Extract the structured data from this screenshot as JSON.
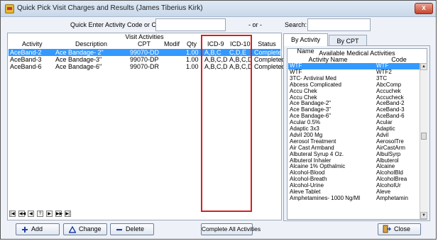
{
  "window": {
    "title": "Quick Pick Visit Charges and Results (James Tiberius Kirk)",
    "close_glyph": "x"
  },
  "quick_enter": {
    "label": "Quick Enter Activity Code or CPT:",
    "value": "",
    "or_label": "- or -",
    "search_label": "Search:",
    "search_value": ""
  },
  "visit_activities": {
    "caption": "Visit Activities",
    "columns": [
      "Activity",
      "Description",
      "CPT",
      "Modif",
      "Qty",
      "ICD-9",
      "ICD-10",
      "Status"
    ],
    "rows": [
      {
        "activity": "AceBand-2",
        "description": "Ace Bandage- 2\"",
        "cpt": "99070-DD",
        "modif": "",
        "qty": "1.00",
        "icd9": "A,B,C",
        "icd10": "C,D,E",
        "status": "Completed",
        "selected": true
      },
      {
        "activity": "AceBand-3",
        "description": "Ace Bandage-3\"",
        "cpt": "99070-DP",
        "modif": "",
        "qty": "1.00",
        "icd9": "A,B,C,D",
        "icd10": "A,B,C,D",
        "status": "Completed",
        "selected": false
      },
      {
        "activity": "AceBand-6",
        "description": "Ace Bandage-6\"",
        "cpt": "99070-DR",
        "modif": "",
        "qty": "1.00",
        "icd9": "A,B,C,D",
        "icd10": "A,B,C,D",
        "status": "Completed",
        "selected": false
      }
    ],
    "pager_glyphs": [
      "|◀",
      "◀◀",
      "◀",
      "?",
      "▶",
      "▶▶",
      "▶|"
    ]
  },
  "tabs": [
    {
      "label": "By Activity Name",
      "active": true
    },
    {
      "label": "By CPT Code",
      "active": false
    }
  ],
  "medical_activities": {
    "caption": "Available Medical Activities",
    "columns": [
      "Activity Name",
      "Code"
    ],
    "rows": [
      {
        "name": "WTF",
        "code": "WTF",
        "selected": true
      },
      {
        "name": "WTF",
        "code": "WTF2"
      },
      {
        "name": "3TC- Antiviral Med",
        "code": "3TC"
      },
      {
        "name": "Abcess Complicated",
        "code": "AbcComp"
      },
      {
        "name": "Accu Chek",
        "code": "Accuchek"
      },
      {
        "name": "Accu Chek",
        "code": "Accucheck"
      },
      {
        "name": "Ace Bandage-2\"",
        "code": "AceBand-2"
      },
      {
        "name": "Ace Bandage-3\"",
        "code": "AceBand-3"
      },
      {
        "name": "Ace Bandage-6\"",
        "code": "AceBand-6"
      },
      {
        "name": "Acular 0.5%",
        "code": "Acular"
      },
      {
        "name": "Adaptic 3x3",
        "code": "Adaptic"
      },
      {
        "name": "Advil 200 Mg",
        "code": "Advil"
      },
      {
        "name": "Aerosol Treatment",
        "code": "AerosolTre"
      },
      {
        "name": "Air Cast Armband",
        "code": "AirCastArm"
      },
      {
        "name": "Albuteral Syrup 4 Oz.",
        "code": "AlbulSyrp"
      },
      {
        "name": "Albuterol Inhaler",
        "code": "Albuterol"
      },
      {
        "name": "Alcaine 1% Opthalmic",
        "code": "Alcaine"
      },
      {
        "name": "Alcohol-Blood",
        "code": "AlcoholBld"
      },
      {
        "name": "Alcohol-Breath",
        "code": "AlcoholBrea"
      },
      {
        "name": "Alcohol-Urine",
        "code": "AlcoholUr"
      },
      {
        "name": "Aleve Tablet",
        "code": "Aleve"
      },
      {
        "name": "Amphetamines- 1000 Ng/Ml",
        "code": "Amphetamin"
      }
    ]
  },
  "buttons": {
    "add": "Add",
    "change": "Change",
    "delete": "Delete",
    "complete_all": "Complete All Activities",
    "close": "Close"
  },
  "colors": {
    "selection": "#3399ff",
    "highlight_border": "#d2211f",
    "add_icon": "#1c3fa8"
  }
}
